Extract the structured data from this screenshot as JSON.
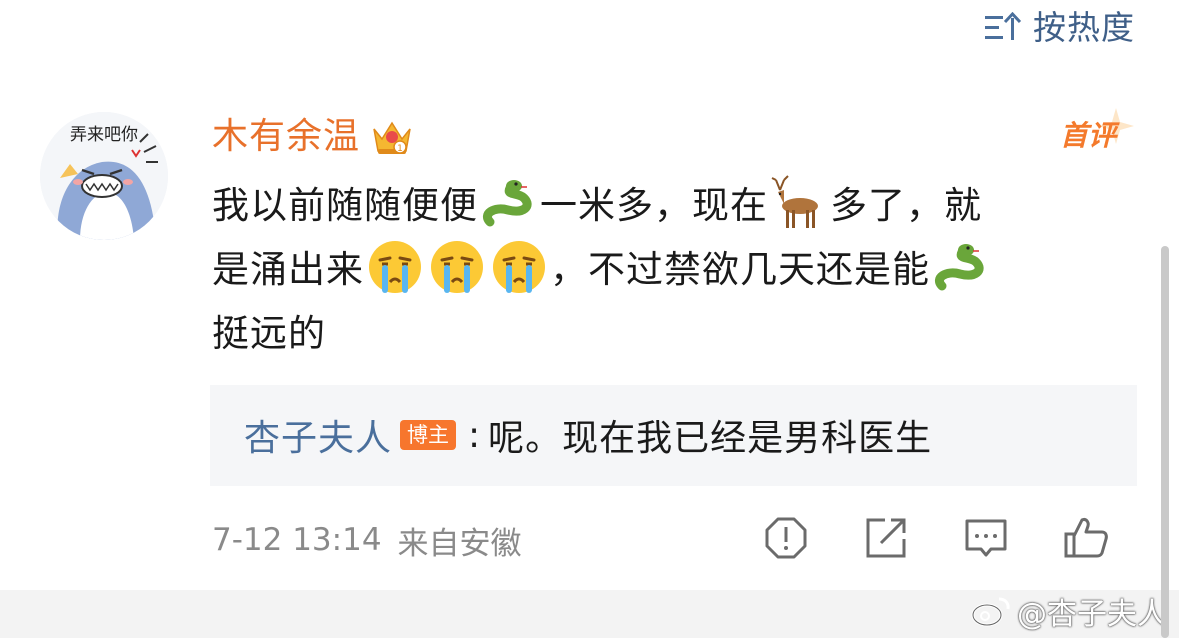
{
  "sort": {
    "icon": "sort-icon",
    "label": "按热度"
  },
  "comment": {
    "avatar_text": "弄来吧你",
    "author": "木有余温",
    "author_icon": "crown-icon",
    "first_badge": "首评",
    "body": {
      "line1": [
        "我以前随随便便",
        "一米多，现在",
        "多了，就"
      ],
      "line2": [
        "是涌出来",
        "，不过禁欲几天还是能"
      ],
      "line3": "挺远的"
    },
    "emojis": [
      "snake-emoji",
      "deer-emoji",
      "crying-emoji",
      "crying-emoji",
      "crying-emoji",
      "snake-emoji"
    ],
    "reply": {
      "author": "杏子夫人",
      "badge": "博主",
      "separator": ":",
      "text": "呢。现在我已经是男科医生"
    },
    "meta": {
      "date": "7-12 13:14",
      "location": "来自安徽"
    },
    "actions": [
      "report-icon",
      "share-icon",
      "comment-icon",
      "like-icon"
    ]
  },
  "watermark": {
    "icon": "weibo-logo-icon",
    "text": "@杏子夫人"
  },
  "colors": {
    "author": "#e8712b",
    "link_blue": "#4a6f9c",
    "badge_orange": "#f7762d",
    "reply_bg": "#f5f6f8",
    "meta_gray": "#8a8a8a"
  }
}
